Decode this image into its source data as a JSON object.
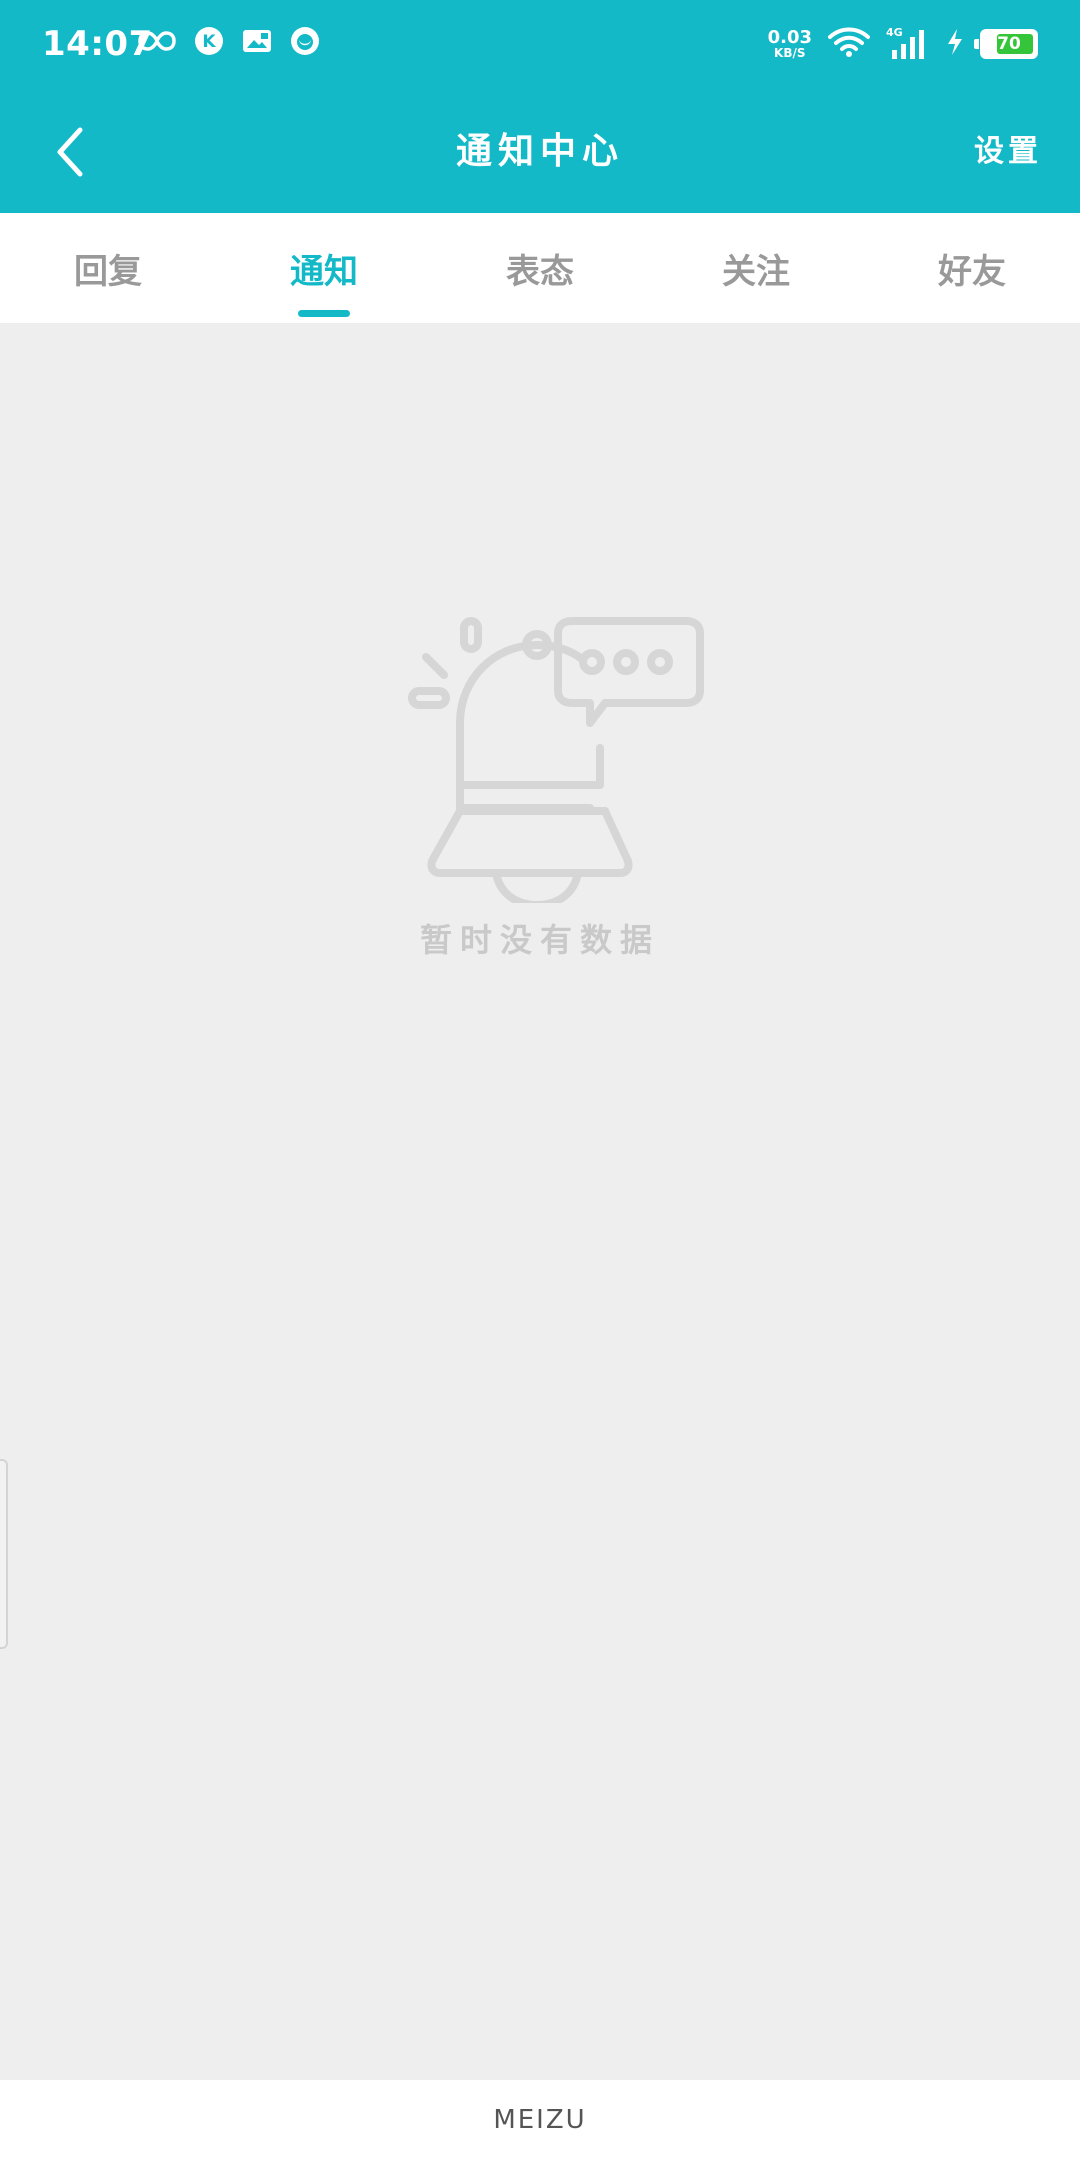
{
  "status_bar": {
    "time": "14:07",
    "net_speed_value": "0.03",
    "net_speed_unit": "KB/S",
    "network_type": "4G",
    "battery_level": "70",
    "left_icons": [
      "infinity-icon",
      "k-app-icon",
      "image-notification-icon",
      "drop-app-icon"
    ],
    "right_icons": [
      "wifi-icon",
      "signal-icon",
      "charging-icon",
      "battery-icon"
    ]
  },
  "header": {
    "title": "通知中心",
    "settings_label": "设置",
    "back_icon": "chevron-left-icon"
  },
  "tabs": {
    "items": [
      {
        "label": "回复",
        "active": false
      },
      {
        "label": "通知",
        "active": true
      },
      {
        "label": "表态",
        "active": false
      },
      {
        "label": "关注",
        "active": false
      },
      {
        "label": "好友",
        "active": false
      }
    ]
  },
  "empty_state": {
    "icon": "bell-message-icon",
    "text": "暂时没有数据"
  },
  "footer": {
    "brand": "MEIZU"
  },
  "colors": {
    "primary": "#14b9c8",
    "tab_inactive": "#999999",
    "background": "#eeeeee",
    "empty_text": "#c9c9c9",
    "battery_fill": "#35c53a"
  }
}
